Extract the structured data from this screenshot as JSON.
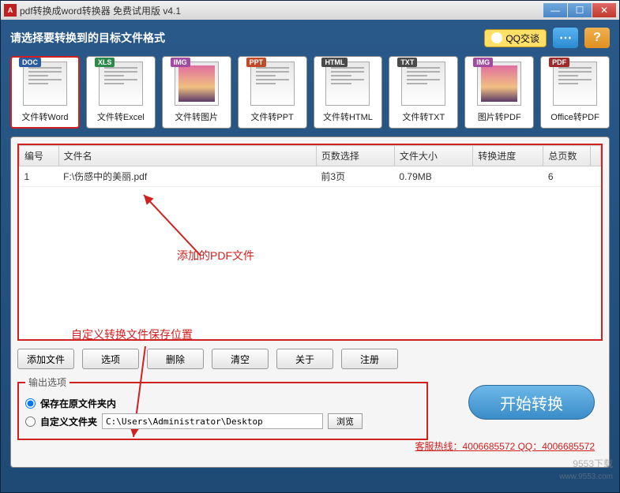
{
  "window": {
    "title": "pdf转换成word转换器 免费试用版 v4.1",
    "icon_letter": "A"
  },
  "header": {
    "prompt": "请选择要转换到的目标文件格式",
    "qq_label": "QQ交谈",
    "chat_glyph": "⋯",
    "help_glyph": "?"
  },
  "formats": [
    {
      "tag": "DOC",
      "tag_cls": "tag-doc",
      "label": "文件转Word",
      "selected": true
    },
    {
      "tag": "XLS",
      "tag_cls": "tag-xls",
      "label": "文件转Excel"
    },
    {
      "tag": "IMG",
      "tag_cls": "tag-img",
      "label": "文件转图片"
    },
    {
      "tag": "PPT",
      "tag_cls": "tag-ppt",
      "label": "文件转PPT"
    },
    {
      "tag": "HTML",
      "tag_cls": "tag-html",
      "label": "文件转HTML"
    },
    {
      "tag": "TXT",
      "tag_cls": "tag-txt",
      "label": "文件转TXT"
    },
    {
      "tag": "IMG",
      "tag_cls": "tag-img",
      "label": "图片转PDF"
    },
    {
      "tag": "PDF",
      "tag_cls": "tag-pdf",
      "label": "Office转PDF"
    }
  ],
  "table": {
    "headers": {
      "num": "编号",
      "name": "文件名",
      "pages": "页数选择",
      "size": "文件大小",
      "progress": "转换进度",
      "total": "总页数"
    },
    "rows": [
      {
        "num": "1",
        "name": "F:\\伤感中的美丽.pdf",
        "pages": "前3页",
        "size": "0.79MB",
        "progress": "",
        "total": "6"
      }
    ]
  },
  "annotations": {
    "added_file": "添加的PDF文件",
    "custom_path": "自定义转换文件保存位置"
  },
  "buttons": {
    "add": "添加文件",
    "options": "选项",
    "delete": "删除",
    "clear": "清空",
    "about": "关于",
    "register": "注册"
  },
  "output": {
    "legend": "输出选项",
    "opt1": "保存在原文件夹内",
    "opt2": "自定义文件夹",
    "path": "C:\\Users\\Administrator\\Desktop",
    "browse": "浏览"
  },
  "start": "开始转换",
  "hotline": "客服热线：4006685572 QQ：4006685572",
  "watermark": {
    "site": "9553下载",
    "url": "www.9553.com"
  }
}
